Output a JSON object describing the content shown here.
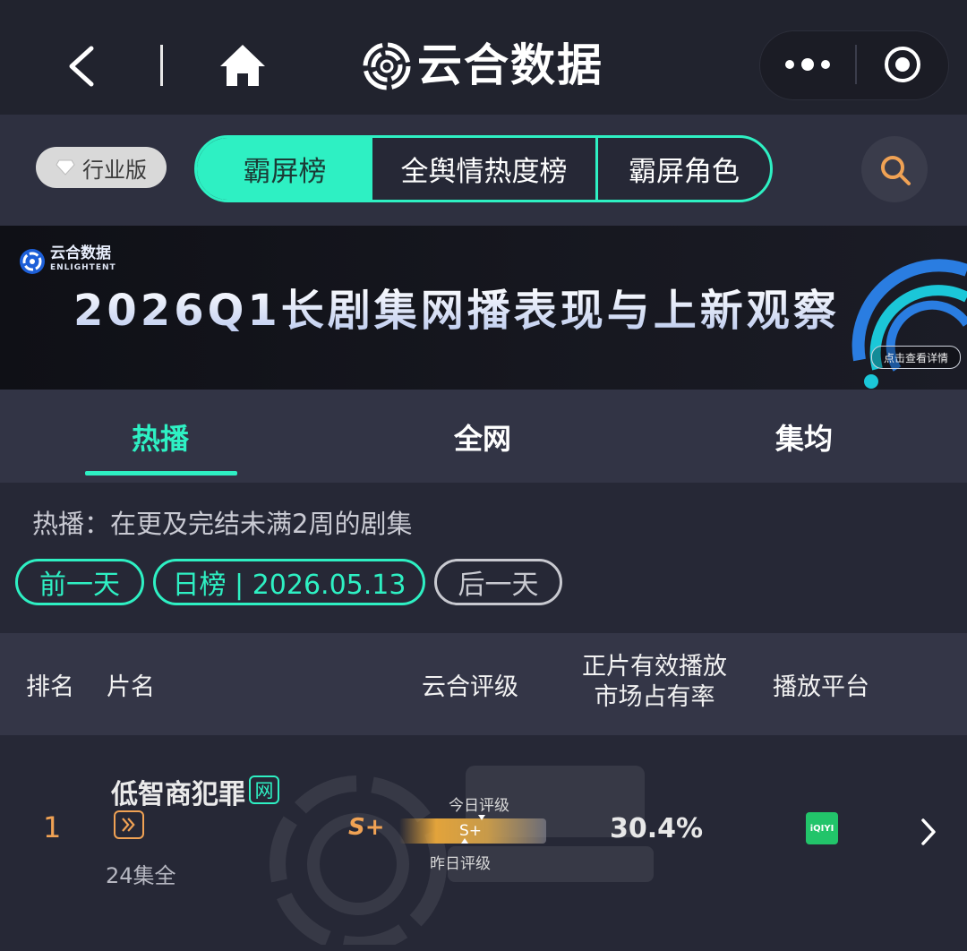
{
  "header": {
    "title": "云合数据"
  },
  "filters": {
    "edition_label": "行业版",
    "tabs": [
      {
        "label": "霸屏榜",
        "active": true
      },
      {
        "label": "全舆情热度榜",
        "active": false
      },
      {
        "label": "霸屏角色",
        "active": false
      }
    ]
  },
  "banner": {
    "brand_cn": "云合数据",
    "brand_en": "ENLIGHTENT",
    "title": "2026Q1长剧集网播表现与上新观察",
    "cta": "点击查看详情"
  },
  "subtabs": [
    {
      "label": "热播",
      "active": true
    },
    {
      "label": "全网",
      "active": false
    },
    {
      "label": "集均",
      "active": false
    }
  ],
  "description": "热播：在更及完结未满2周的剧集",
  "date_nav": {
    "prev_label": "前一天",
    "current_label": "日榜 | 2026.05.13",
    "next_label": "后一天"
  },
  "table": {
    "headers": {
      "rank": "排名",
      "name": "片名",
      "grade": "云合评级",
      "share_line1": "正片有效播放",
      "share_line2": "市场占有率",
      "platform": "播放平台"
    },
    "rows": [
      {
        "rank": "1",
        "title": "低智商犯罪",
        "net_badge": "网",
        "episodes": "24集全",
        "grade": "S+",
        "grade_today_label": "今日评级",
        "grade_yesterday_label": "昨日评级",
        "grade_bar_value": "S+",
        "share": "30.4%",
        "platform": "iQIYI"
      }
    ]
  },
  "colors": {
    "accent": "#2ef0c3",
    "rank": "#f0a254",
    "background": "#22232f"
  }
}
